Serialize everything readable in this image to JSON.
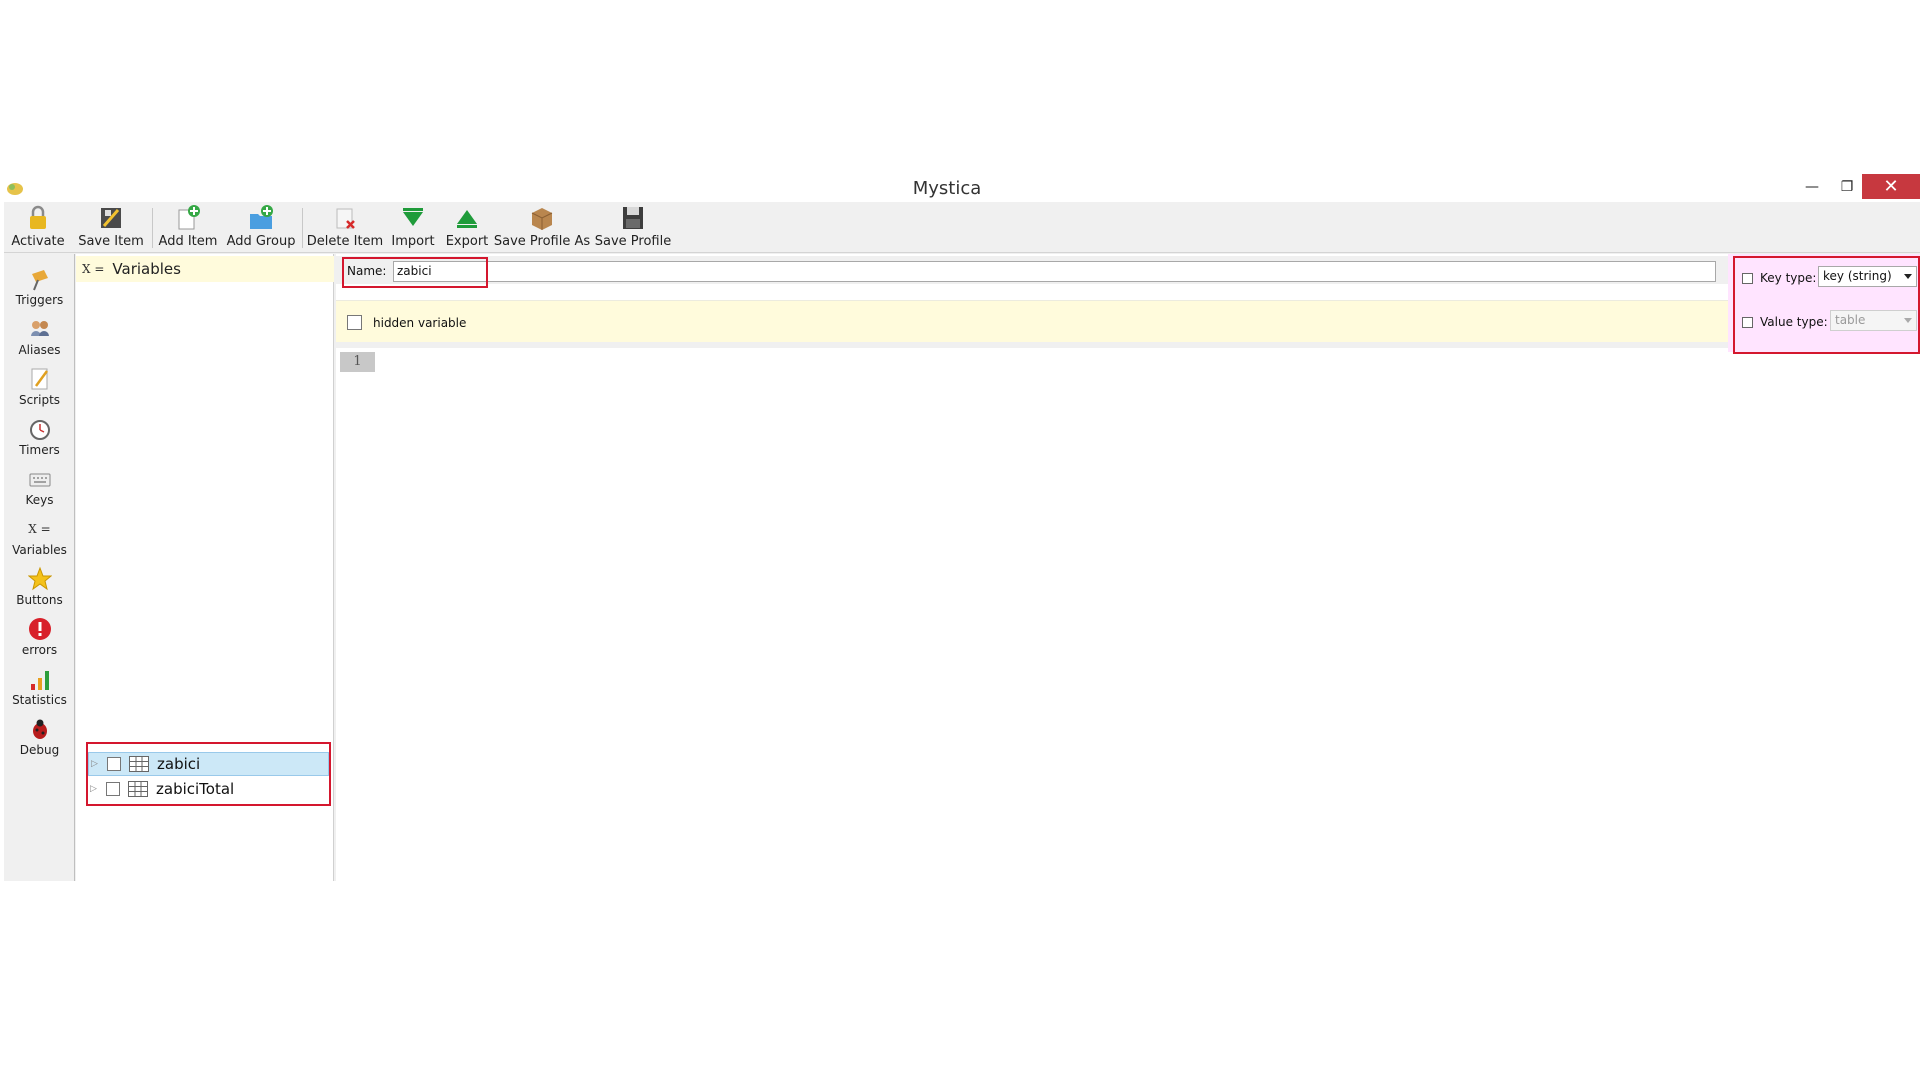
{
  "window": {
    "title": "Mystica"
  },
  "toolbar": {
    "activate": "Activate",
    "save_item": "Save Item",
    "add_item": "Add Item",
    "add_group": "Add Group",
    "delete_item": "Delete Item",
    "import": "Import",
    "export": "Export",
    "save_profile_as": "Save Profile As",
    "save_profile": "Save Profile"
  },
  "nav": {
    "triggers": "Triggers",
    "aliases": "Aliases",
    "scripts": "Scripts",
    "timers": "Timers",
    "keys": "Keys",
    "variables": "Variables",
    "buttons": "Buttons",
    "errors": "errors",
    "statistics": "Statistics",
    "debug": "Debug",
    "variables_glyph": "X ="
  },
  "tree": {
    "header_glyph": "X =",
    "header_label": "Variables",
    "items": [
      {
        "label": "zabici",
        "selected": true
      },
      {
        "label": "zabiciTotal",
        "selected": false
      }
    ]
  },
  "editor": {
    "name_label": "Name:",
    "name_value": "zabici",
    "hidden_label": "hidden variable",
    "line_number": "1"
  },
  "types": {
    "key_type_label": "Key type:",
    "key_type_value": "key (string)",
    "value_type_label": "Value type:",
    "value_type_value": "table"
  },
  "colors": {
    "highlight_red": "#d4172e",
    "close_button": "#c7383f",
    "header_yellow": "#fffbdc",
    "selection_blue": "#cce8f7",
    "type_panel_pink": "#ffe4ff"
  }
}
